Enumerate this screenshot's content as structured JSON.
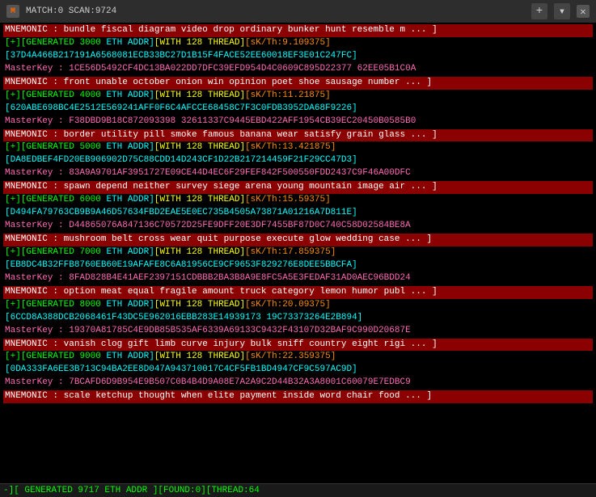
{
  "titlebar": {
    "icon": "M",
    "title": "MATCH:0 SCAN:9724",
    "close_label": "✕",
    "plus_label": "+",
    "arrow_label": "▾"
  },
  "blocks": [
    {
      "mnemonic": "MNEMONIC : bundle fiscal diagram video drop ordinary bunker hunt resemble m ... ]",
      "generated": "[+][GENERATED 3000 ETH ADDR][WITH 128 THREAD][sK/Th:9.109375]",
      "addr": "[37D4A466B217191A6568081ECB33BC27D1B15F4FACE52EE60018EF3E01C247FC]",
      "masterkey": "MasterKey :  1CE56D5492CF4DC13BA022DD7DFC39EFD954D4C0609C895D22377 62EE05B1C0A"
    },
    {
      "mnemonic": "MNEMONIC : front unable october onion win opinion poet shoe sausage number ... ]",
      "generated": "[+][GENERATED 4000 ETH ADDR][WITH 128 THREAD][sK/Th:11.21875]",
      "addr": "[620ABE698BC4E2512E569241AFF0F6C4AFCCE68458C7F3C0FDB3952DA68F9226]",
      "masterkey": "MasterKey :  F38DBD9B18C872093398 32611337C9445EBD422AFF1954CB39EC20450B0585B0"
    },
    {
      "mnemonic": "MNEMONIC : border utility pill smoke famous banana wear satisfy grain glass ... ]",
      "generated": "[+][GENERATED 5000 ETH ADDR][WITH 128 THREAD][sK/Th:13.421875]",
      "addr": "[DA8EDBEF4FD20EB906902D75C88CDD14D243CF1D22B217214459F21F29CC47D3]",
      "masterkey": "MasterKey :  83A9A9701AF3951727E09CE44D4EC6F29FEF842F500550FDD2437C9F46A00DFC"
    },
    {
      "mnemonic": "MNEMONIC : spawn depend neither survey siege arena young mountain image air ... ]",
      "generated": "[+][GENERATED 6000 ETH ADDR][WITH 128 THREAD][sK/Th:15.59375]",
      "addr": "[D494FA79763CB9B9A46D57634FBD2EAE5E0EC735B4505A73871A01216A7D811E]",
      "masterkey": "MasterKey :  D44865076A847136C70572D25FE9DFF20E3DF7455BF87D0C740C58D02584BE8A"
    },
    {
      "mnemonic": "MNEMONIC : mushroom belt cross wear quit purpose execute glow wedding case ... ]",
      "generated": "[+][GENERATED 7000 ETH ADDR][WITH 128 THREAD][sK/Th:17.859375]",
      "addr": "[EB8DC4B32FFB8760EB60E19AFAFE8C6A81956CE9CF9653F829276E8DEE5BBCFA]",
      "masterkey": "MasterKey :  8FAD828B4E41AEF2397151CDBBB2BA3B8A9E8FC5A5E3FEDAF31AD0AEC96BDD24"
    },
    {
      "mnemonic": "MNEMONIC : option meat equal fragile amount truck category lemon humor publ ... ]",
      "generated": "[+][GENERATED 8000 ETH ADDR][WITH 128 THREAD][sK/Th:20.09375]",
      "addr": "[6CCD8A388DCB2068461F43DC5E962016EBB283E14939173 19C73373264E2B894]",
      "masterkey": "MasterKey :  19370A81785C4E9DB85B535AF6339A69133C9432F43107D32BAF9C990D20687E"
    },
    {
      "mnemonic": "MNEMONIC : vanish clog gift limb curve injury bulk sniff country eight rigi ... ]",
      "generated": "[+][GENERATED 9000 ETH ADDR][WITH 128 THREAD][sK/Th:22.359375]",
      "addr": "[0DA333FA6EE3B713C94BA2EE8D047A943710017C4CF5FB1BD4947CF9C597AC9D]",
      "masterkey": "MasterKey :  7BCAFD6D9B954E9B507C0B4B4D9A08E7A2A9C2D44B32A3A8001C60079E7EDBC9"
    },
    {
      "mnemonic": "MNEMONIC : scale ketchup thought when elite payment inside word chair food ... ]",
      "generated": "",
      "addr": "",
      "masterkey": ""
    }
  ],
  "status_bar": {
    "text": "-][ GENERATED 9717 ETH ADDR ][FOUND:0][THREAD:64"
  }
}
